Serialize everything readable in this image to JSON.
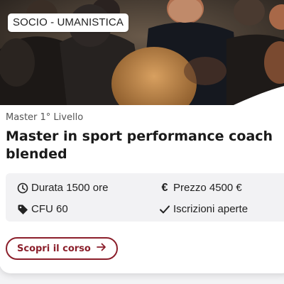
{
  "card": {
    "category_badge": "SOCIO - UMANISTICA",
    "level": "Master 1° Livello",
    "title": "Master in sport performance coach blended",
    "info": {
      "duration": "Durata 1500 ore",
      "price": "Prezzo 4500 €",
      "cfu": "CFU 60",
      "status": "Iscrizioni aperte"
    },
    "cta_label": "Scopri il corso"
  },
  "icons": {
    "duration": "clock-icon",
    "price": "euro-icon",
    "cfu": "tag-icon",
    "status": "check-icon",
    "cta": "arrow-right-icon"
  },
  "colors": {
    "accent": "#8b1f2b",
    "info_bg": "#f2f2f4"
  }
}
